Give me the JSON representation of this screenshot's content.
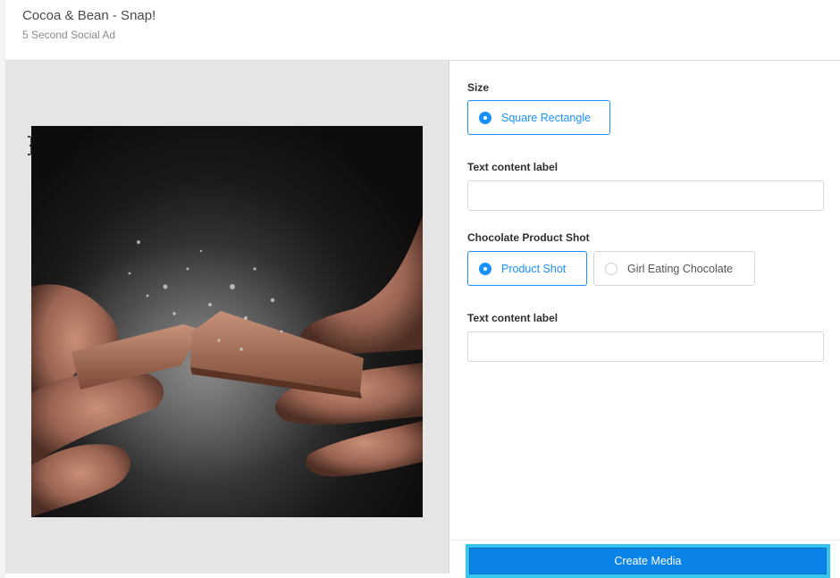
{
  "header": {
    "title": "Cocoa & Bean - Snap!",
    "subtitle": "5 Second Social Ad"
  },
  "preview": {
    "image_icon": "chocolate-photo",
    "cursor_icon": "text-cursor-icon"
  },
  "form": {
    "size": {
      "label": "Size",
      "options": [
        {
          "label": "Square Rectangle",
          "selected": true
        }
      ]
    },
    "text_content_1": {
      "label": "Text content label",
      "value": "",
      "placeholder": ""
    },
    "product_shot": {
      "label": "Chocolate Product Shot",
      "options": [
        {
          "label": "Product Shot",
          "selected": true
        },
        {
          "label": "Girl Eating Chocolate",
          "selected": false
        }
      ]
    },
    "text_content_2": {
      "label": "Text content label",
      "value": "",
      "placeholder": ""
    }
  },
  "footer": {
    "create_label": "Create Media"
  },
  "colors": {
    "accent": "#1a90ff",
    "button": "#0a84e8",
    "button_highlight": "#36c4f0",
    "preview_bg": "#e5e5e5"
  }
}
